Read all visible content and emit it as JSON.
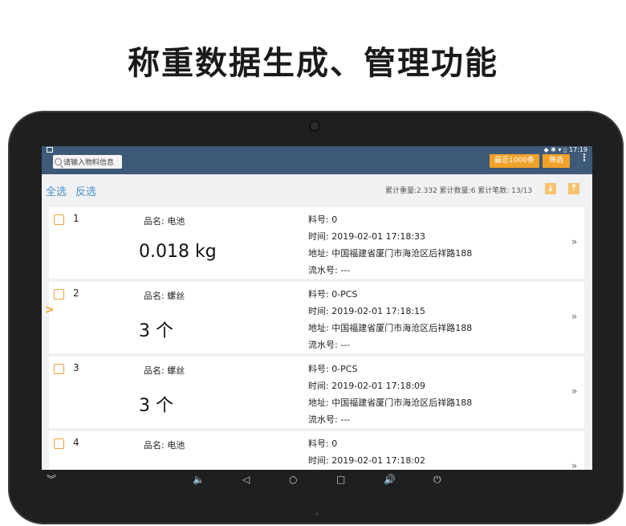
{
  "headline": "称重数据生成、管理功能",
  "status": {
    "time": "17:19",
    "icons": "◆ ✱ ▾ ▯"
  },
  "appbar": {
    "search_placeholder": "请输入物料信息",
    "recent_button": "最近1000条",
    "filter_button": "筛选",
    "menu_glyph": "⋮"
  },
  "toolbar": {
    "select_all": "全选",
    "invert": "反选",
    "stats": "累计重量:2.332 累计数量:6  累计笔数: 13/13",
    "icon_down": "⤓",
    "icon_up": "⤒"
  },
  "records": [
    {
      "index": "1",
      "name": "品名: 电池",
      "value": "0.018 kg",
      "material": "料号: 0",
      "time": "时间: 2019-02-01 17:18:33",
      "address": "地址: 中国福建省厦门市海沧区后祥路188",
      "serial": "流水号: ---",
      "chevron": "»"
    },
    {
      "index": "2",
      "name": "品名: 螺丝",
      "value": "3 个",
      "material": "料号: 0-PCS",
      "time": "时间: 2019-02-01 17:18:15",
      "address": "地址: 中国福建省厦门市海沧区后祥路188",
      "serial": "流水号: ---",
      "chevron": "»"
    },
    {
      "index": "3",
      "name": "品名: 螺丝",
      "value": "3 个",
      "material": "料号: 0-PCS",
      "time": "时间: 2019-02-01 17:18:09",
      "address": "地址: 中国福建省厦门市海沧区后祥路188",
      "serial": "流水号: ---",
      "chevron": "»"
    },
    {
      "index": "4",
      "name": "品名: 电池",
      "value": "",
      "material": "料号: 0",
      "time": "时间: 2019-02-01 17:18:02",
      "address": "",
      "serial": "",
      "chevron": "»"
    }
  ],
  "side_marker": ">",
  "navbar": {
    "collapse": "︾",
    "vol_down": "🔈",
    "back": "◁",
    "home": "○",
    "recents": "□",
    "vol_up": "🔊",
    "power": "⏻"
  }
}
